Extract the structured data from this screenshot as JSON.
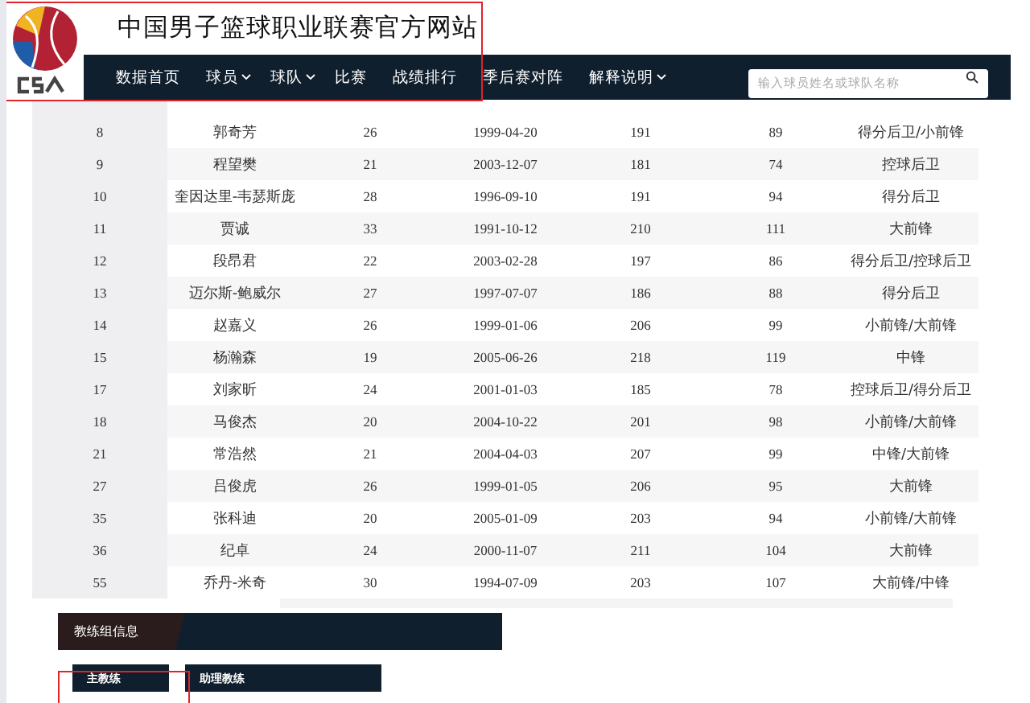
{
  "site_title": "中国男子篮球职业联赛官方网站",
  "nav": [
    {
      "label": "数据首页",
      "dropdown": false
    },
    {
      "label": "球员",
      "dropdown": true
    },
    {
      "label": "球队",
      "dropdown": true
    },
    {
      "label": "比赛",
      "dropdown": false
    },
    {
      "label": "战绩排行",
      "dropdown": false
    },
    {
      "label": "季后赛对阵",
      "dropdown": false
    },
    {
      "label": "解释说明",
      "dropdown": true
    }
  ],
  "search": {
    "placeholder": "输入球员姓名或球队名称"
  },
  "roster": [
    [
      "8",
      "郭奇芳",
      "26",
      "1999-04-20",
      "191",
      "89",
      "得分后卫/小前锋"
    ],
    [
      "9",
      "程望樊",
      "21",
      "2003-12-07",
      "181",
      "74",
      "控球后卫"
    ],
    [
      "10",
      "奎因达里-韦瑟斯庞",
      "28",
      "1996-09-10",
      "191",
      "94",
      "得分后卫"
    ],
    [
      "11",
      "贾诚",
      "33",
      "1991-10-12",
      "210",
      "111",
      "大前锋"
    ],
    [
      "12",
      "段昂君",
      "22",
      "2003-02-28",
      "197",
      "86",
      "得分后卫/控球后卫"
    ],
    [
      "13",
      "迈尔斯-鲍威尔",
      "27",
      "1997-07-07",
      "186",
      "88",
      "得分后卫"
    ],
    [
      "14",
      "赵嘉义",
      "26",
      "1999-01-06",
      "206",
      "99",
      "小前锋/大前锋"
    ],
    [
      "15",
      "杨瀚森",
      "19",
      "2005-06-26",
      "218",
      "119",
      "中锋"
    ],
    [
      "17",
      "刘家昕",
      "24",
      "2001-01-03",
      "185",
      "78",
      "控球后卫/得分后卫"
    ],
    [
      "18",
      "马俊杰",
      "20",
      "2004-10-22",
      "201",
      "98",
      "小前锋/大前锋"
    ],
    [
      "21",
      "常浩然",
      "21",
      "2004-04-03",
      "207",
      "99",
      "中锋/大前锋"
    ],
    [
      "27",
      "吕俊虎",
      "26",
      "1999-01-05",
      "206",
      "95",
      "大前锋"
    ],
    [
      "35",
      "张科迪",
      "20",
      "2005-01-09",
      "203",
      "94",
      "小前锋/大前锋"
    ],
    [
      "36",
      "纪卓",
      "24",
      "2000-11-07",
      "211",
      "104",
      "大前锋"
    ],
    [
      "55",
      "乔丹-米奇",
      "30",
      "1994-07-09",
      "203",
      "107",
      "大前锋/中锋"
    ]
  ],
  "coach_section": {
    "title": "教练组信息",
    "tabs": [
      "主教练",
      "助理教练"
    ]
  }
}
